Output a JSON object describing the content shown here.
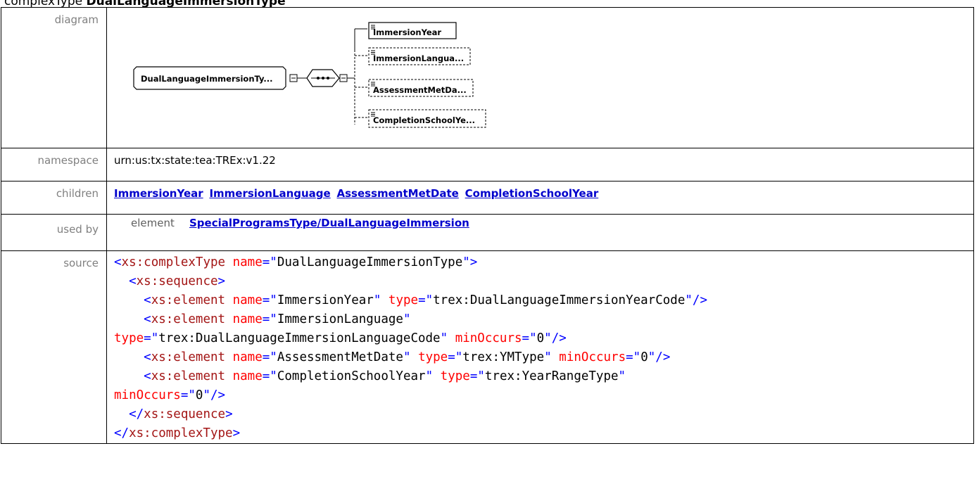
{
  "page_title": {
    "prefix": "complexType ",
    "name": "DualLanguageImmersionType"
  },
  "labels": {
    "diagram": "diagram",
    "namespace": "namespace",
    "children": "children",
    "used_by": "used by",
    "source": "source"
  },
  "diagram": {
    "root": "DualLanguageImmersionTy...",
    "children": [
      {
        "label": "ImmersionYear",
        "optional": false
      },
      {
        "label": "ImmersionLangua...",
        "optional": true
      },
      {
        "label": "AssessmentMetDa...",
        "optional": true
      },
      {
        "label": "CompletionSchoolYe...",
        "optional": true
      }
    ]
  },
  "namespace": "urn:us:tx:state:tea:TREx:v1.22",
  "children": [
    "ImmersionYear",
    "ImmersionLanguage",
    "AssessmentMetDate",
    "CompletionSchoolYear"
  ],
  "used_by": {
    "kind": "element",
    "link": "SpecialProgramsType/DualLanguageImmersion"
  },
  "source": {
    "complex_type_name": "DualLanguageImmersionType",
    "elements": [
      {
        "name": "ImmersionYear",
        "type": "trex:DualLanguageImmersionYearCode"
      },
      {
        "name": "ImmersionLanguage",
        "type": "trex:DualLanguageImmersionLanguageCode",
        "minOccurs": "0"
      },
      {
        "name": "AssessmentMetDate",
        "type": "trex:YMType",
        "minOccurs": "0"
      },
      {
        "name": "CompletionSchoolYear",
        "type": "trex:YearRangeType",
        "minOccurs": "0"
      }
    ]
  }
}
